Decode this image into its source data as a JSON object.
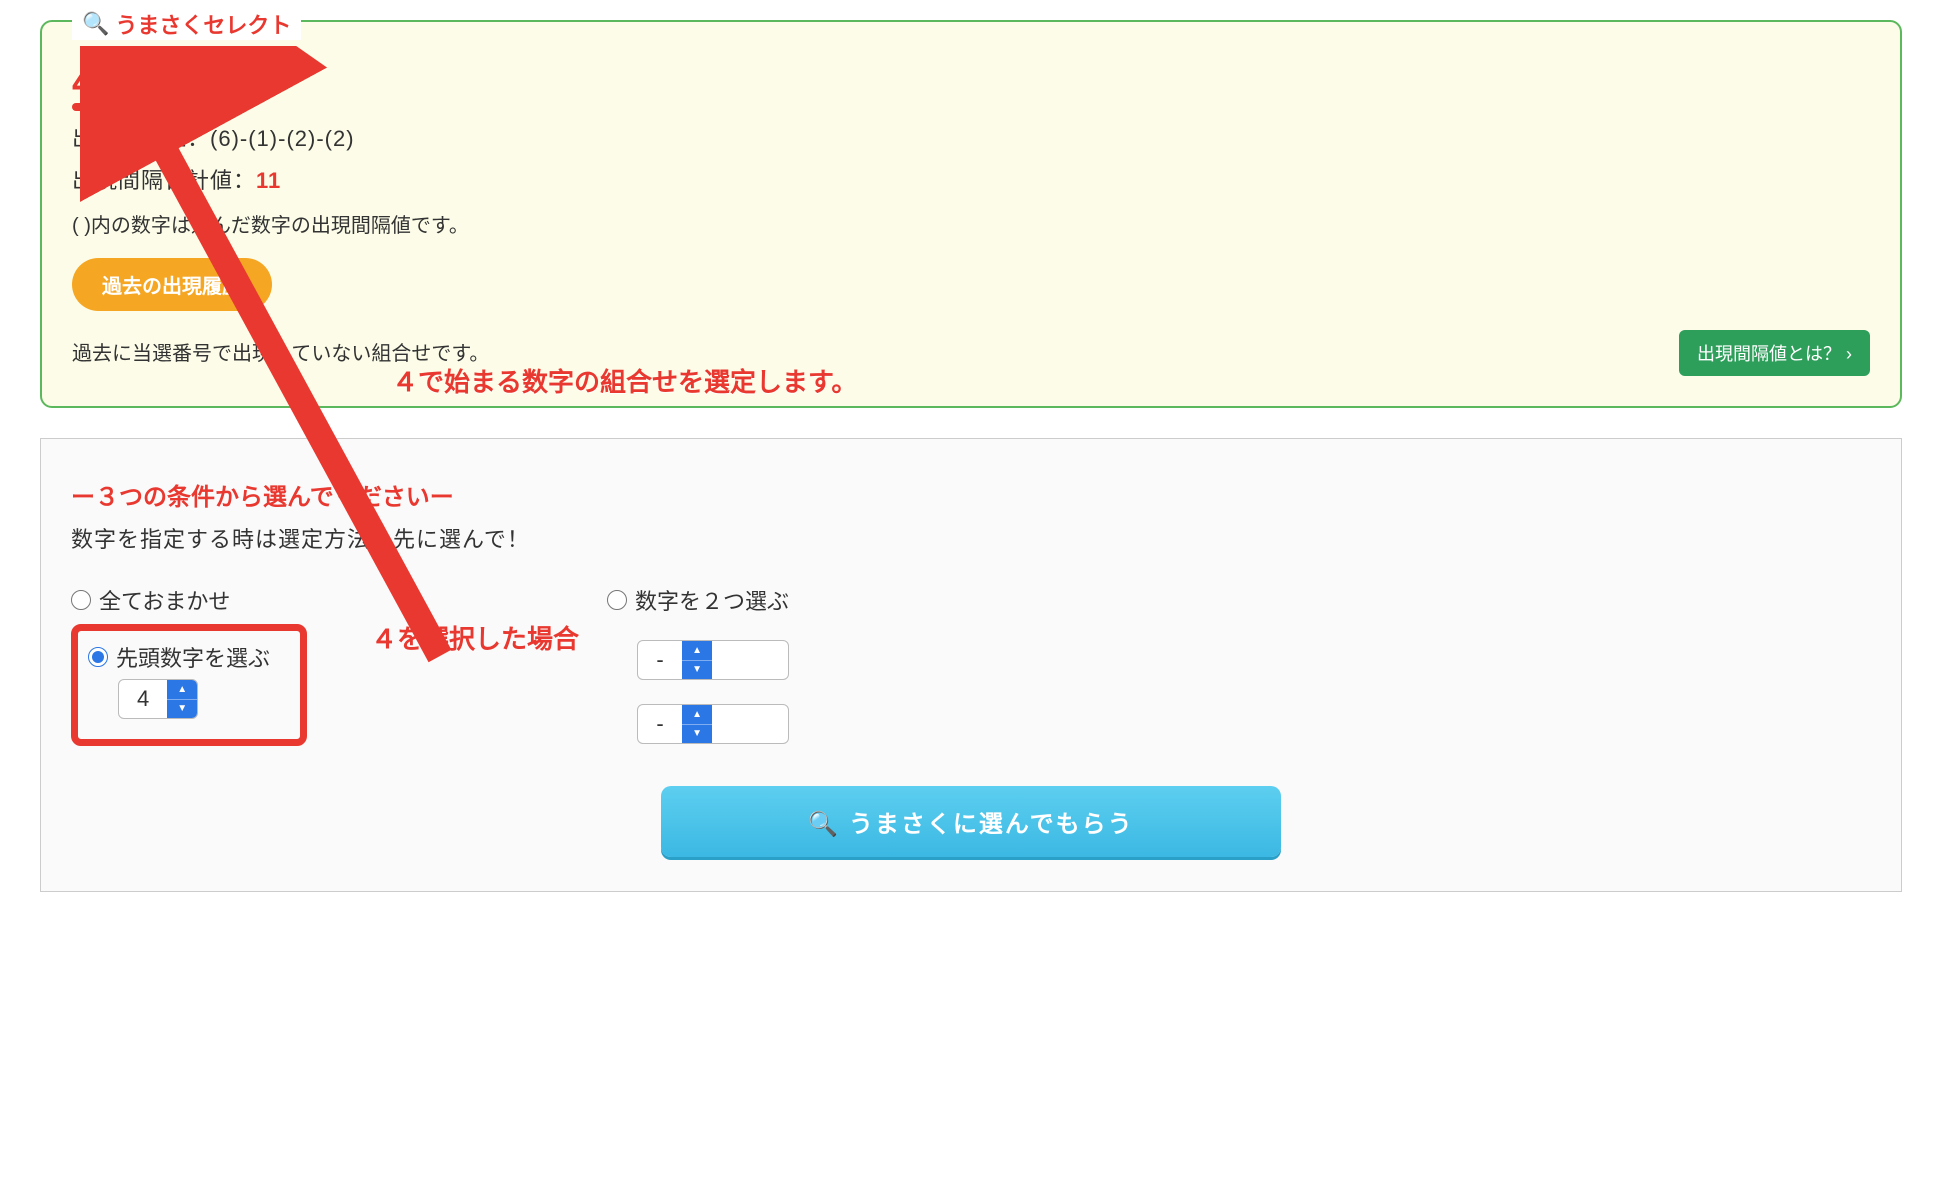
{
  "top_panel": {
    "legend": "うまさくセレクト",
    "result_number": "4-3-1-1",
    "interval_label": "出現間隔値：",
    "interval_values": "(6)-(1)-(2)-(2)",
    "interval_sum_label": "出現間隔合計値：",
    "interval_sum_value": "11",
    "note": "( )内の数字は選んだ数字の出現間隔値です。",
    "history_btn": "過去の出現履歴",
    "note2": "過去に当選番号で出現していない組合せです。",
    "callout": "４で始まる数字の組合せを選定します。",
    "info_tag": "出現間隔値とは？ ›"
  },
  "bottom_panel": {
    "title": "ー３つの条件から選んでくださいー",
    "subtitle": "数字を指定する時は選定方法を先に選んで！",
    "opt_all": "全ておまかせ",
    "opt_first": "先頭数字を選ぶ",
    "opt_first_value": "4",
    "opt_two": "数字を２つ選ぶ",
    "opt_two_value1": "-",
    "opt_two_value2": "-",
    "side_callout": "４を選択した場合",
    "primary_btn": "うまさくに選んでもらう"
  }
}
